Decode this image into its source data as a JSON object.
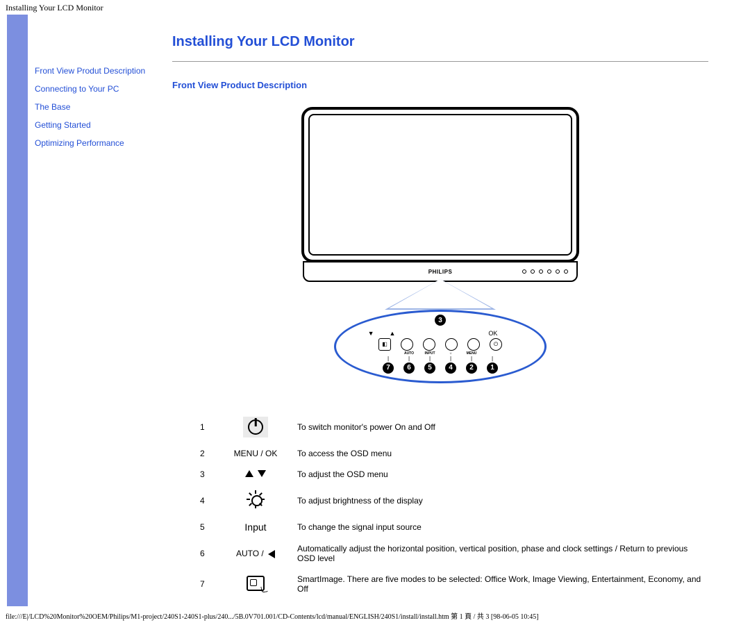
{
  "header_title": "Installing Your LCD Monitor",
  "sidebar": {
    "items": [
      {
        "label": "Front View Produt Description"
      },
      {
        "label": "Connecting to Your PC"
      },
      {
        "label": "The Base"
      },
      {
        "label": "Getting Started"
      },
      {
        "label": "Optimizing Performance"
      }
    ]
  },
  "main": {
    "h1": "Installing Your LCD Monitor",
    "h2": "Front View Product Description",
    "brand": "PHILIPS",
    "oval": {
      "top_badge": "3",
      "arrow_up": "▲",
      "arrow_down": "▼",
      "ok_label": "OK",
      "labels": [
        "",
        "AUTO",
        "INPUT",
        "☼",
        "MENU",
        ""
      ],
      "numbers": [
        "7",
        "6",
        "5",
        "4",
        "2",
        "1"
      ]
    },
    "rows": [
      {
        "n": "1",
        "icon_type": "power",
        "icon_text": "",
        "desc": "To switch monitor's power On and Off"
      },
      {
        "n": "2",
        "icon_type": "text",
        "icon_text": "MENU / OK",
        "desc": "To access the OSD menu"
      },
      {
        "n": "3",
        "icon_type": "updown",
        "icon_text": "",
        "desc": "To adjust the OSD menu"
      },
      {
        "n": "4",
        "icon_type": "brightness",
        "icon_text": "",
        "desc": "To adjust brightness of the display"
      },
      {
        "n": "5",
        "icon_type": "text",
        "icon_text": "Input",
        "desc": "To change the signal input source"
      },
      {
        "n": "6",
        "icon_type": "autoleft",
        "icon_text": "AUTO / ",
        "desc": "Automatically adjust the horizontal position, vertical position, phase and clock settings / Return to previous OSD level"
      },
      {
        "n": "7",
        "icon_type": "smartimage",
        "icon_text": "",
        "desc": "SmartImage. There are five modes to be selected: Office Work, Image Viewing, Entertainment, Economy, and Off"
      }
    ]
  },
  "footer": "file:///E|/LCD%20Monitor%20OEM/Philips/M1-project/240S1-240S1-plus/240.../5B.0V701.001/CD-Contents/lcd/manual/ENGLISH/240S1/install/install.htm 第 1 頁 / 共 3  [98-06-05 10:45]"
}
